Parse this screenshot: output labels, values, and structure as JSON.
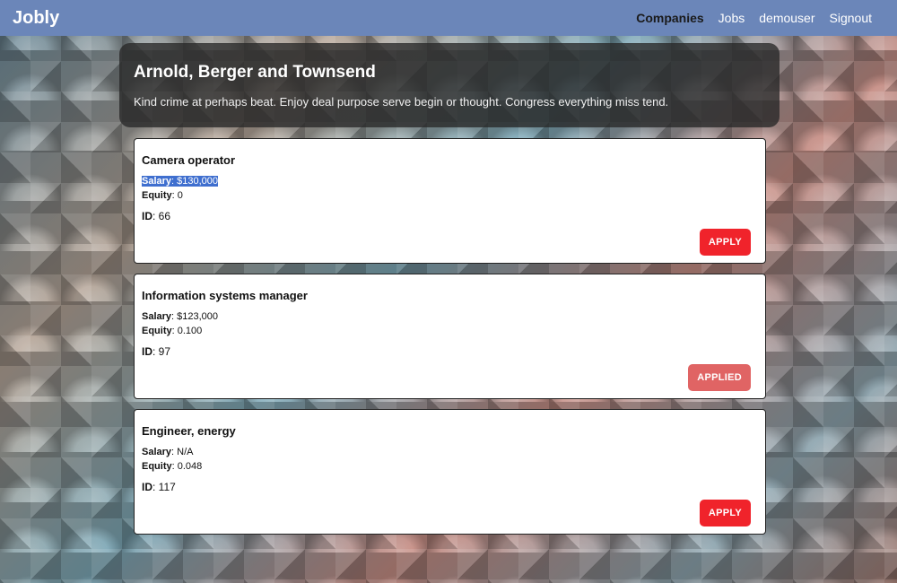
{
  "nav": {
    "brand": "Jobly",
    "links": [
      {
        "label": "Companies"
      },
      {
        "label": "Jobs"
      },
      {
        "label": "demouser"
      },
      {
        "label": "Signout"
      }
    ]
  },
  "company": {
    "name": "Arnold, Berger and Townsend",
    "description": "Kind crime at perhaps beat. Enjoy deal purpose serve begin or thought. Congress everything miss tend."
  },
  "labels": {
    "salary": "Salary",
    "equity": "Equity",
    "id": "ID"
  },
  "jobs": [
    {
      "title": "Camera operator",
      "salary": "$130,000",
      "equity": "0",
      "id": "66",
      "button": "APPLY",
      "state": "apply"
    },
    {
      "title": "Information systems manager",
      "salary": "$123,000",
      "equity": "0.100",
      "id": "97",
      "button": "APPLIED",
      "state": "applied"
    },
    {
      "title": "Engineer, energy",
      "salary": "N/A",
      "equity": "0.048",
      "id": "117",
      "button": "APPLY",
      "state": "apply"
    }
  ],
  "colors": {
    "navbar": "#6b86b9",
    "apply": "#f0232b",
    "applied": "#e06464",
    "selection": "#3f6fcf"
  }
}
